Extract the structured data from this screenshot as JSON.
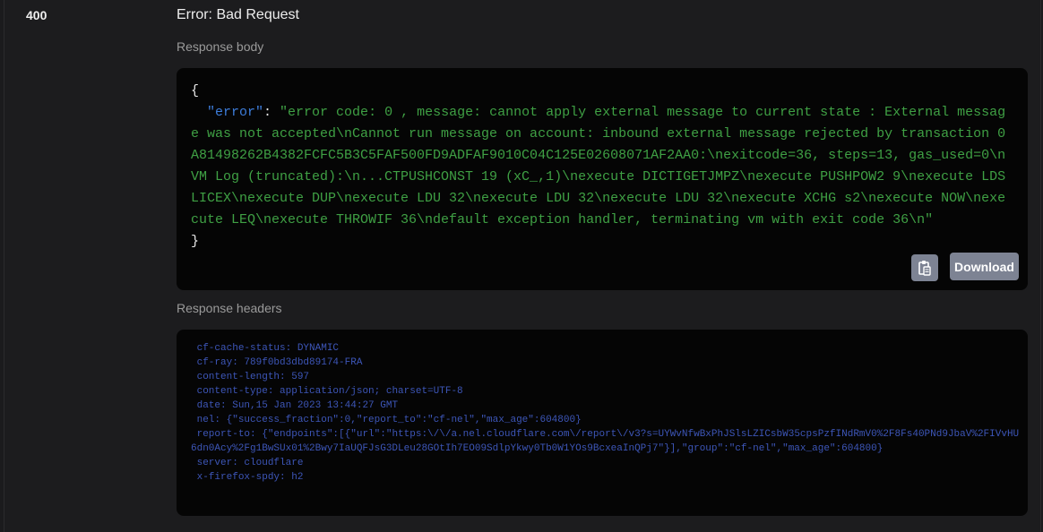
{
  "response": {
    "status_code": "400",
    "description": "Error: Bad Request",
    "body_label": "Response body",
    "body": {
      "open_brace": "{",
      "indent": "  ",
      "key": "\"error\"",
      "colon": ": ",
      "value": "\"error code: 0 , message: cannot apply external message to current state : External message was not accepted\\nCannot run message on account: inbound external message rejected by transaction 0A81498262B4382FCFC5B3C5FAF500FD9ADFAF9010C04C125E02608071AF2AA0:\\nexitcode=36, steps=13, gas_used=0\\nVM Log (truncated):\\n...CTPUSHCONST 19 (xC_,1)\\nexecute DICTIGETJMPZ\\nexecute PUSHPOW2 9\\nexecute LDSLICEX\\nexecute DUP\\nexecute LDU 32\\nexecute LDU 32\\nexecute LDU 32\\nexecute XCHG s2\\nexecute NOW\\nexecute LEQ\\nexecute THROWIF 36\\ndefault exception handler, terminating vm with exit code 36\\n\"",
      "close_brace": "}"
    },
    "copy_icon": "clipboard-icon",
    "download_label": "Download",
    "headers_label": "Response headers",
    "headers": " cf-cache-status: DYNAMIC \n cf-ray: 789f0bd3dbd89174-FRA \n content-length: 597 \n content-type: application/json; charset=UTF-8 \n date: Sun,15 Jan 2023 13:44:27 GMT \n nel: {\"success_fraction\":0,\"report_to\":\"cf-nel\",\"max_age\":604800} \n report-to: {\"endpoints\":[{\"url\":\"https:\\/\\/a.nel.cloudflare.com\\/report\\/v3?s=UYWvNfwBxPhJSlsLZICsbW35cpsPzfINdRmV0%2F8Fs40PNd9JbaV%2FIVvHU6dn0Acy%2Fg1BwSUx01%2Bwy7IaUQFJsG3DLeu28GOtIh7EO09SdlpYkwy0Tb0W1YOs9BcxeaInQPj7\"}],\"group\":\"cf-nel\",\"max_age\":604800} \n server: cloudflare \n x-firefox-spdy: h2 "
  },
  "colors": {
    "json_key": "#3d7ddb",
    "json_string": "#3fa044",
    "headers_text": "#3d56b8",
    "button_bg": "#7d8393"
  }
}
